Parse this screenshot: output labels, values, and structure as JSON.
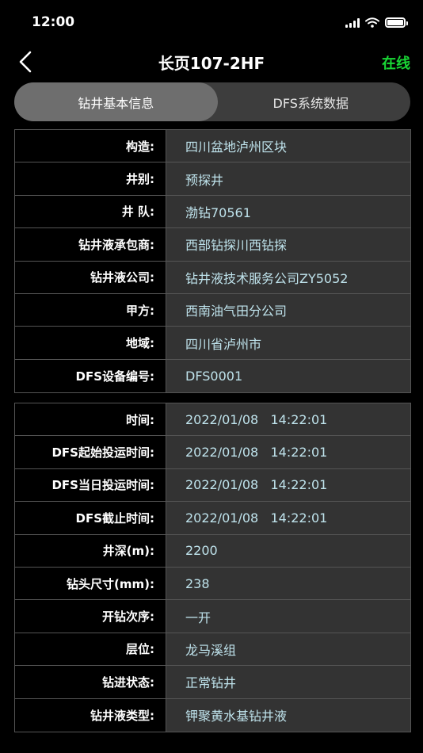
{
  "status_bar": {
    "time": "12:00"
  },
  "nav": {
    "title": "长页107-2HF",
    "status": "在线"
  },
  "tabs": [
    {
      "label": "钻井基本信息",
      "active": true
    },
    {
      "label": "DFS系统数据",
      "active": false
    }
  ],
  "basic_info": [
    {
      "label": "构造:",
      "value": "四川盆地泸州区块"
    },
    {
      "label": "井别:",
      "value": "预探井"
    },
    {
      "label": "井 队:",
      "value": "渤钻70561"
    },
    {
      "label": "钻井液承包商:",
      "value": "西部钻探川西钻探"
    },
    {
      "label": "钻井液公司:",
      "value": "钻井液技术服务公司ZY5052"
    },
    {
      "label": "甲方:",
      "value": "西南油气田分公司"
    },
    {
      "label": "地域:",
      "value": "四川省泸州市"
    },
    {
      "label": "DFS设备编号:",
      "value": "DFS0001"
    }
  ],
  "run_info": [
    {
      "label": "时间:",
      "value": "2022/01/08   14:22:01"
    },
    {
      "label": "DFS起始投运时间:",
      "value": "2022/01/08   14:22:01"
    },
    {
      "label": "DFS当日投运时间:",
      "value": "2022/01/08   14:22:01"
    },
    {
      "label": "DFS截止时间:",
      "value": "2022/01/08   14:22:01"
    },
    {
      "label": "井深(m):",
      "value": "2200"
    },
    {
      "label": "钻头尺寸(mm):",
      "value": "238"
    },
    {
      "label": "开钻次序:",
      "value": "一开"
    },
    {
      "label": "层位:",
      "value": "龙马溪组"
    },
    {
      "label": "钻进状态:",
      "value": "正常钻井"
    },
    {
      "label": "钻井液类型:",
      "value": "钾聚黄水基钻井液"
    }
  ],
  "colors": {
    "online": "#19d635",
    "value_text": "#bfe3ec",
    "value_bg": "#333333"
  },
  "icons": {
    "back": "chevron-left-icon",
    "signal": "signal-icon",
    "wifi": "wifi-icon",
    "battery": "battery-icon"
  }
}
